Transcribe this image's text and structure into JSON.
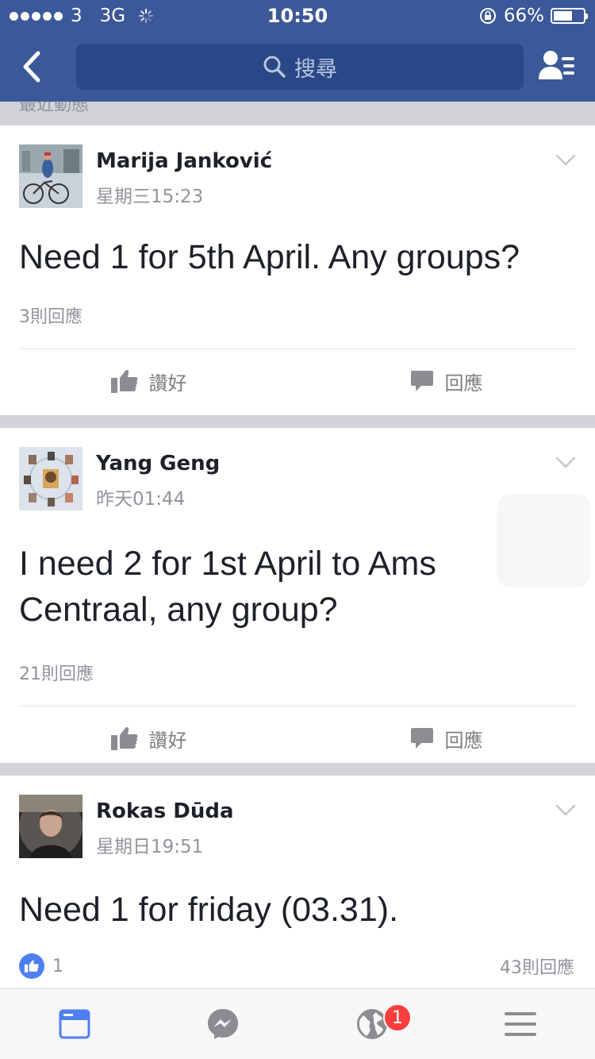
{
  "status_bar": {
    "carrier": "3",
    "network": "3G",
    "time": "10:50",
    "battery": "66%",
    "battery_level": 0.66
  },
  "nav": {
    "search_placeholder": "搜尋"
  },
  "section_peek": "最近動態",
  "posts": [
    {
      "author": "Marija Janković",
      "time": "星期三15:23",
      "text": "Need 1 for 5th April. Any groups?",
      "comments": "3則回應",
      "like_label": "讚好",
      "comment_label": "回應"
    },
    {
      "author": "Yang Geng",
      "time": "昨天01:44",
      "text": "I need 2 for 1st April to Ams Centraal, any group?",
      "comments": "21則回應",
      "like_label": "讚好",
      "comment_label": "回應"
    },
    {
      "author": "Rokas Dūda",
      "time": "星期日19:51",
      "text": "Need 1 for friday (03.31).",
      "likes": "1",
      "comments": "43則回應"
    }
  ],
  "tabbar": {
    "notification_count": "1"
  },
  "colors": {
    "brand": "#3b5998",
    "badge": "#fa3e3e",
    "like_blue": "#4e7ff0"
  }
}
